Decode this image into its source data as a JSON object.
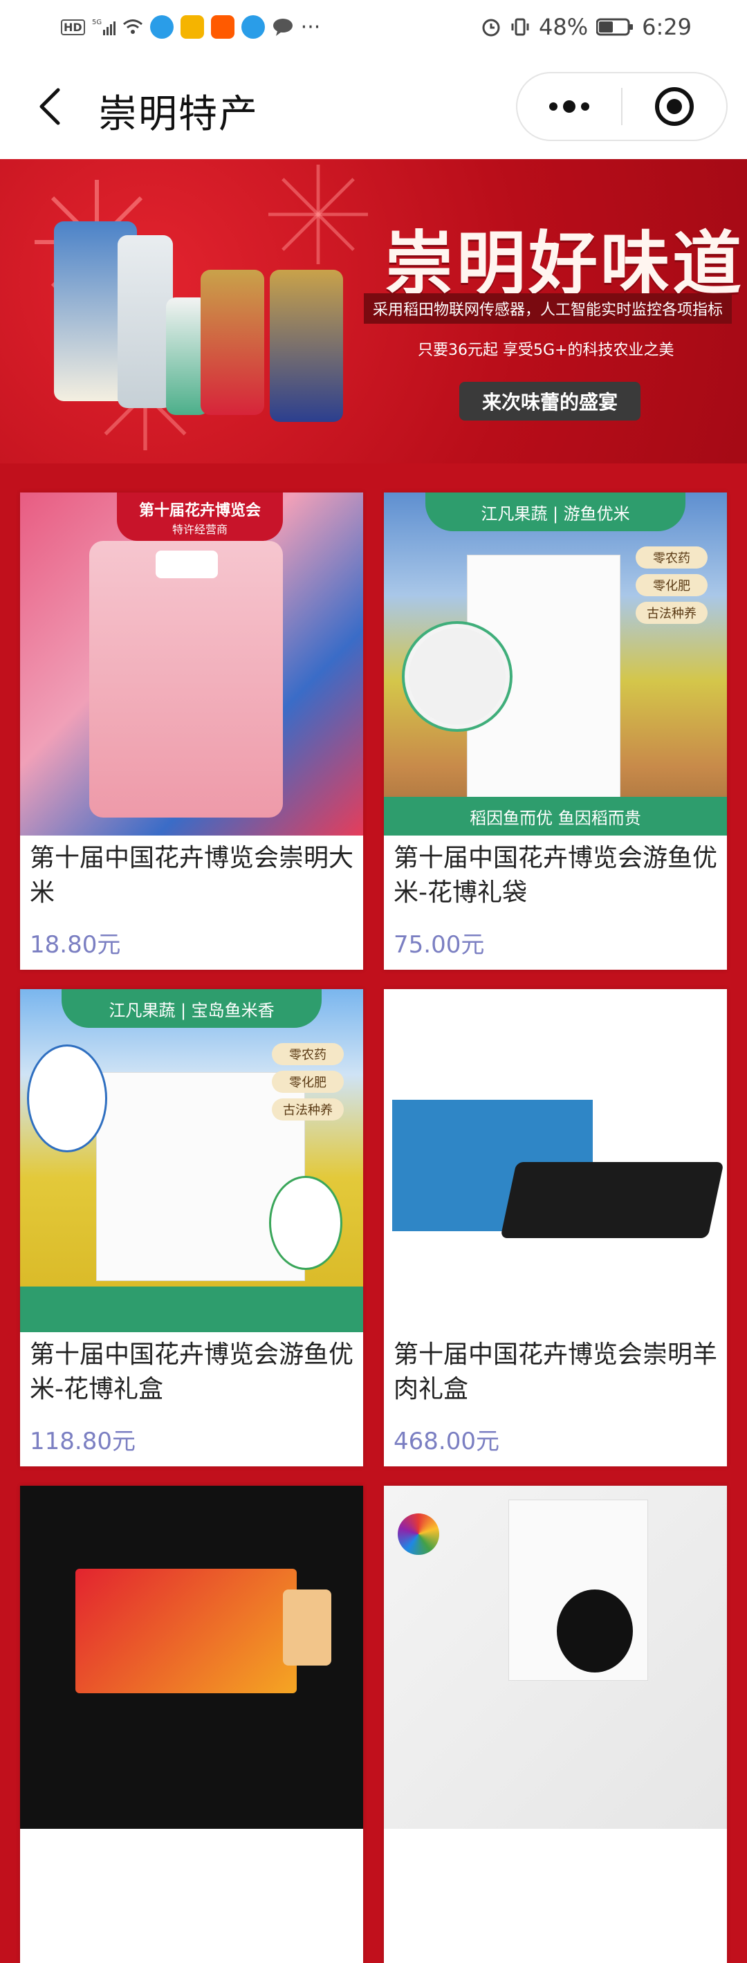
{
  "status_bar": {
    "left_icons": [
      "hd-icon",
      "signal-5g-icon",
      "wifi-icon",
      "app-icon",
      "mail-icon",
      "taobao-icon",
      "app2-icon",
      "chat-icon",
      "more-icon"
    ],
    "battery": "48%",
    "time": "6:29"
  },
  "header": {
    "title": "崇明特产"
  },
  "banner": {
    "title": "崇明好味道",
    "subtitle": "采用稻田物联网传感器，人工智能实时监控各项指标",
    "promo": "只要36元起 享受5G+的科技农业之美",
    "button": "来次味蕾的盛宴"
  },
  "products": [
    {
      "name": "第十届中国花卉博览会崇明大米",
      "price": "18.80元",
      "image": "pink-rice-bag"
    },
    {
      "name": "第十届中国花卉博览会游鱼优米-花博礼袋",
      "price": "75.00元",
      "image": "rice-gift-bag",
      "band_top": "江凡果蔬 | 游鱼优米",
      "band_bottom": "稻因鱼而优    鱼因稻而贵",
      "tags": [
        "零农药",
        "零化肥",
        "古法种养"
      ]
    },
    {
      "name": "第十届中国花卉博览会游鱼优米-花博礼盒",
      "price": "118.80元",
      "image": "rice-gift-box",
      "band_top": "江凡果蔬 | 宝岛鱼米香",
      "tags": [
        "零农药",
        "零化肥",
        "古法种养"
      ]
    },
    {
      "name": "第十届中国花卉博览会崇明羊肉礼盒",
      "price": "468.00元",
      "image": "mutton-gift-box"
    },
    {
      "name": "",
      "price": "",
      "image": "dark-gift-box"
    },
    {
      "name": "",
      "price": "",
      "image": "white-gift-box"
    }
  ],
  "card1_badge": "第十届花卉博览会",
  "card1_badge_sub": "特许经营商",
  "colors": {
    "page_bg": "#c1101c",
    "price": "#7b7fc2",
    "band_green": "#2e9d6d"
  }
}
